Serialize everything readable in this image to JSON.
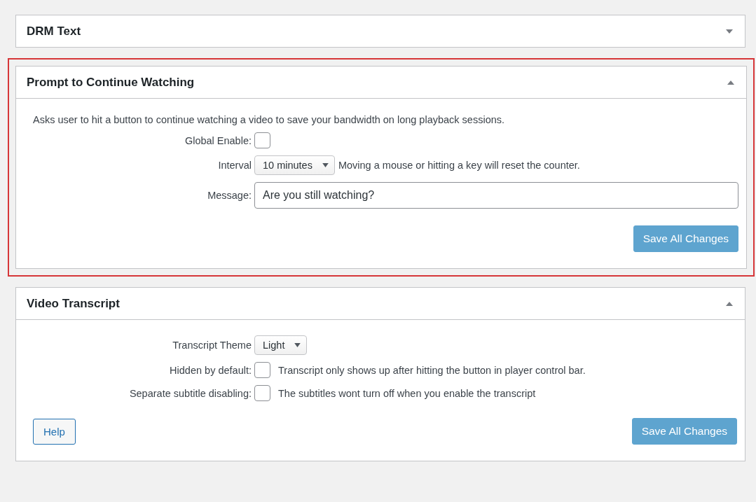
{
  "panels": [
    {
      "title": "DRM Text",
      "expanded": false,
      "highlighted": false
    },
    {
      "title": "Prompt to Continue Watching",
      "expanded": true,
      "highlighted": true,
      "description": "Asks user to hit a button to continue watching a video to save your bandwidth on long playback sessions.",
      "rows": [
        {
          "kind": "checkbox",
          "label": "Global Enable:",
          "checked": false
        },
        {
          "kind": "select",
          "label": "Interval",
          "value": "10 minutes",
          "note": "Moving a mouse or hitting a key will reset the counter."
        },
        {
          "kind": "text",
          "label": "Message:",
          "value": "Are you still watching?"
        }
      ],
      "save": "Save All Changes"
    },
    {
      "title": "Video Transcript",
      "expanded": true,
      "highlighted": false,
      "rows": [
        {
          "kind": "select",
          "label": "Transcript Theme",
          "value": "Light"
        },
        {
          "kind": "checkbox",
          "label": "Hidden by default:",
          "checked": false,
          "note": "Transcript only shows up after hitting the button in player control bar."
        },
        {
          "kind": "checkbox",
          "label": "Separate subtitle disabling:",
          "checked": false,
          "note": "The subtitles wont turn off when you enable the transcript"
        }
      ],
      "help": "Help",
      "save": "Save All Changes"
    }
  ]
}
